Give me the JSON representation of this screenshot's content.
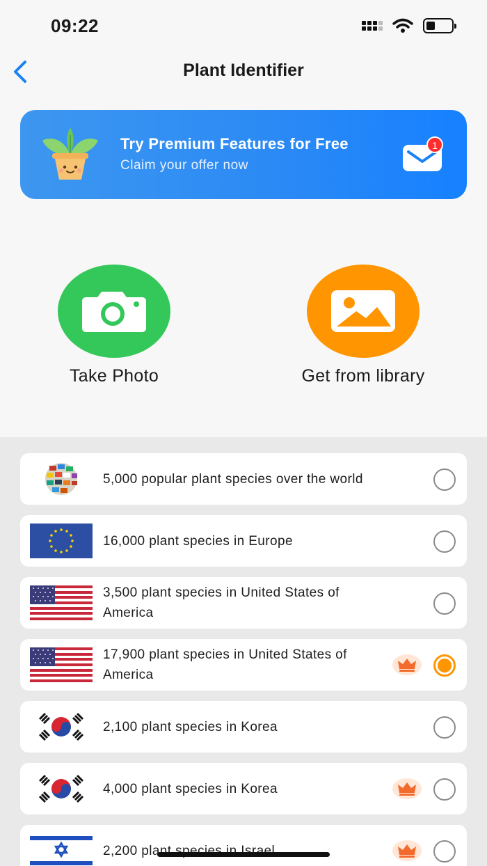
{
  "status": {
    "time": "09:22"
  },
  "nav": {
    "title": "Plant Identifier"
  },
  "promo": {
    "title": "Try Premium Features for Free",
    "subtitle": "Claim your offer now",
    "badge_count": "1"
  },
  "actions": {
    "take_photo_label": "Take Photo",
    "library_label": "Get from library"
  },
  "databases": [
    {
      "flag": "world-globe",
      "label": "5,000 popular plant species over the world",
      "premium": false,
      "selected": false
    },
    {
      "flag": "eu-flag",
      "label": "16,000 plant species in Europe",
      "premium": false,
      "selected": false
    },
    {
      "flag": "us-flag",
      "label": "3,500 plant species in United States of America",
      "premium": false,
      "selected": false
    },
    {
      "flag": "us-flag",
      "label": "17,900 plant species in United States of America",
      "premium": true,
      "selected": true
    },
    {
      "flag": "korea-flag",
      "label": "2,100 plant species in Korea",
      "premium": false,
      "selected": false
    },
    {
      "flag": "korea-flag",
      "label": "4,000 plant species in Korea",
      "premium": true,
      "selected": false
    },
    {
      "flag": "israel-flag",
      "label": "2,200 plant species in Israel",
      "premium": true,
      "selected": false
    }
  ],
  "colors": {
    "accent_blue": "#1a82f5",
    "green": "#34c759",
    "orange": "#ff9500",
    "badge_red": "#ff2d2d"
  }
}
